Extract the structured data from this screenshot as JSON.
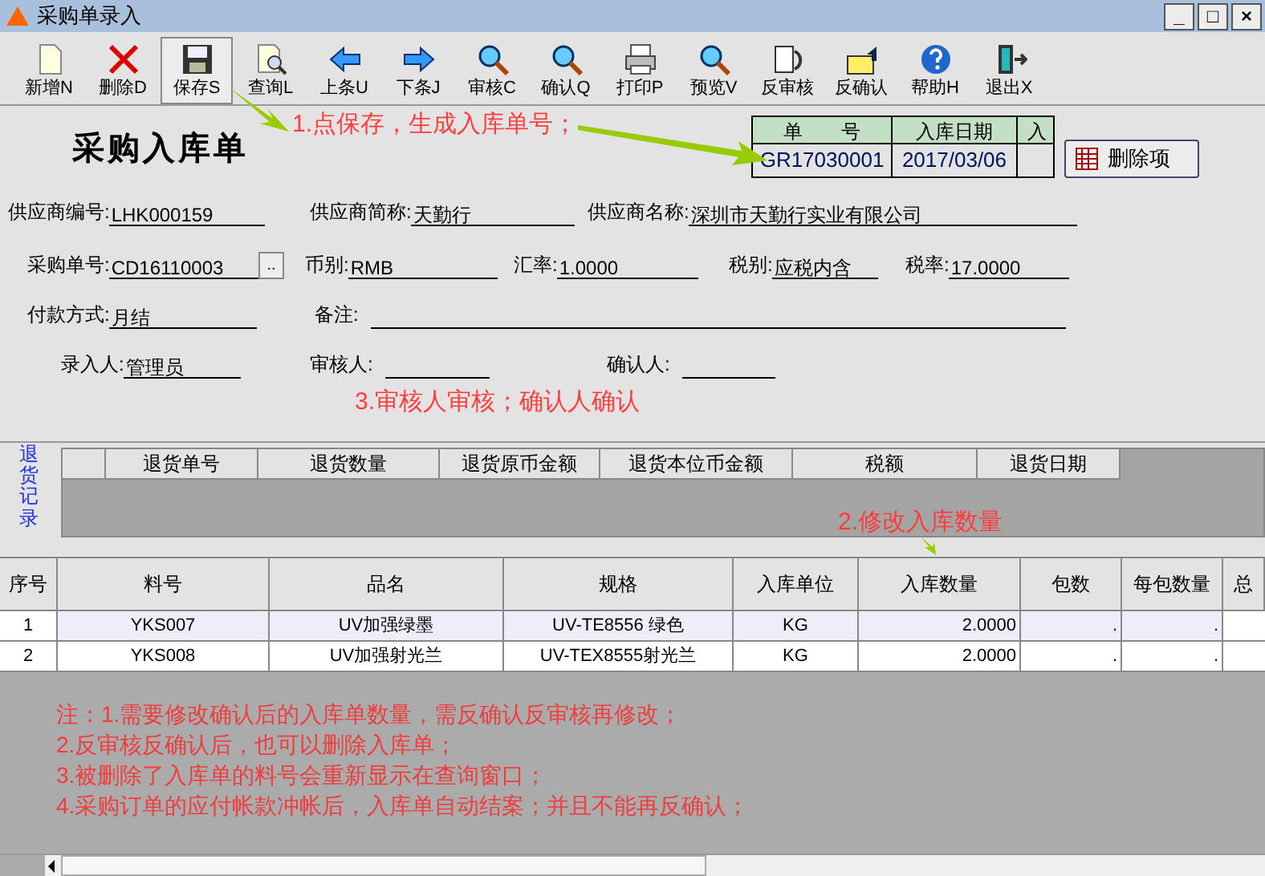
{
  "window": {
    "title": "采购单录入",
    "controls": [
      "_",
      "□",
      "×"
    ]
  },
  "toolbar": [
    {
      "label": "新增N",
      "selected": false
    },
    {
      "label": "删除D",
      "selected": false
    },
    {
      "label": "保存S",
      "selected": true
    },
    {
      "label": "查询L",
      "selected": false
    },
    {
      "label": "上条U",
      "selected": false
    },
    {
      "label": "下条J",
      "selected": false
    },
    {
      "label": "审核C",
      "selected": false
    },
    {
      "label": "确认Q",
      "selected": false
    },
    {
      "label": "打印P",
      "selected": false
    },
    {
      "label": "预览V",
      "selected": false
    },
    {
      "label": "反审核",
      "selected": false
    },
    {
      "label": "反确认",
      "selected": false
    },
    {
      "label": "帮助H",
      "selected": false
    },
    {
      "label": "退出X",
      "selected": false
    }
  ],
  "form_title": "采购入库单",
  "header_table": {
    "columns": [
      "单　　号",
      "入库日期",
      "入"
    ],
    "values": [
      "GR17030001",
      "2017/03/06"
    ]
  },
  "delete_item_button": "删除项",
  "form_rows": [
    [
      {
        "label": "供应商编号:",
        "value": "LHK000159"
      },
      {
        "label": "供应商简称:",
        "value": "天勤行"
      },
      {
        "label": "供应商名称:",
        "value": "深圳市天勤行实业有限公司"
      }
    ],
    [
      {
        "label": "采购单号:",
        "value": "CD16110003",
        "picker": ".."
      },
      {
        "label": "币别:",
        "value": "RMB"
      },
      {
        "label": "汇率:",
        "value": "1.0000"
      },
      {
        "label": "税别:",
        "value": "应税内含"
      },
      {
        "label": "税率:",
        "value": "17.0000"
      }
    ],
    [
      {
        "label": "付款方式:",
        "value": "月结"
      },
      {
        "label": "备注:"
      }
    ],
    [
      {
        "label": "录入人:",
        "value": "管理员"
      },
      {
        "label": "审核人:"
      },
      {
        "label": "确认人:"
      }
    ]
  ],
  "return_records": {
    "side_label": "退货记录",
    "columns": [
      "退货单号",
      "退货数量",
      "退货原币金额",
      "退货本位币金额",
      "税额",
      "退货日期"
    ]
  },
  "grid": {
    "columns": [
      "序号",
      "料号",
      "品名",
      "规格",
      "入库单位",
      "入库数量",
      "包数",
      "每包数量",
      "总"
    ],
    "rows": [
      {
        "selected": true,
        "cells": [
          "1",
          "YKS007",
          "UV加强绿墨",
          "UV-TE8556 绿色",
          "KG",
          "2.0000",
          ".",
          "."
        ]
      },
      {
        "selected": false,
        "cells": [
          "2",
          "YKS008",
          "UV加强射光兰",
          "UV-TEX8555射光兰",
          "KG",
          "2.0000",
          ".",
          "."
        ]
      }
    ]
  },
  "notes": [
    "注：1.需要修改确认后的入库单数量，需反确认反审核再修改；",
    "2.反审核反确认后，也可以删除入库单；",
    "3.被删除了入库单的料号会重新显示在查询窗口；",
    "4.采购订单的应付帐款冲帐后，入库单自动结案；并且不能再反确认；"
  ],
  "annotations": [
    "1.点保存，生成入库单号；",
    "3.审核人审核；确认人确认",
    "2.修改入库数量"
  ]
}
